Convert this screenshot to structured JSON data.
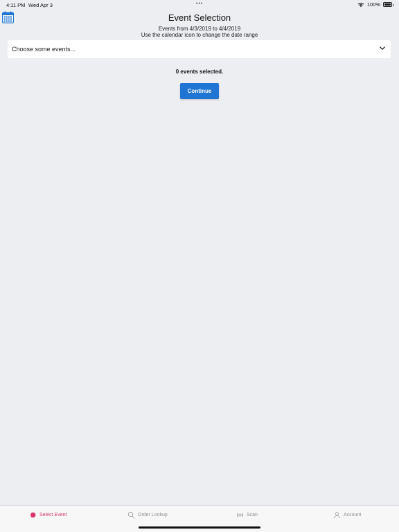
{
  "status_bar": {
    "time": "4:11 PM",
    "date": "Wed Apr 3",
    "dots": "•••",
    "battery": "100%"
  },
  "header": {
    "title": "Event Selection",
    "range_text": "Events from 4/3/2019 to 4/4/2019",
    "hint_text": "Use the calendar icon to change the date range"
  },
  "dropdown": {
    "placeholder": "Choose some events..."
  },
  "selection": {
    "count_text": "0 events selected."
  },
  "actions": {
    "continue_label": "Continue"
  },
  "tab_bar": {
    "items": [
      {
        "label": "Select Event",
        "icon": "gear-icon",
        "active": true
      },
      {
        "label": "Order Lookup",
        "icon": "search-icon",
        "active": false
      },
      {
        "label": "Scan",
        "icon": "barcode-icon",
        "active": false
      },
      {
        "label": "Account",
        "icon": "person-icon",
        "active": false
      }
    ]
  },
  "colors": {
    "background": "#eceef1",
    "accent_blue": "#1f74d4",
    "active_tab": "#d6336c",
    "inactive_tab": "#8e8e93"
  }
}
